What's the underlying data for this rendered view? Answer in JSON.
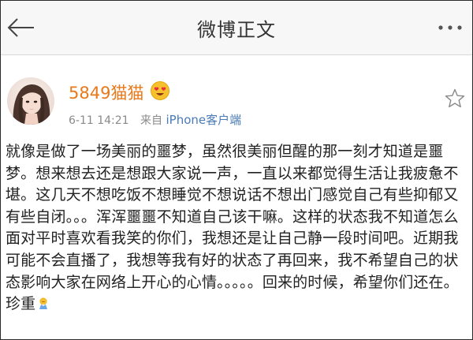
{
  "header": {
    "title": "微博正文",
    "back_icon": "arrow-left-icon",
    "more_icon": "more-dots-icon"
  },
  "post": {
    "username": "5849猫猫",
    "username_color": "#e8791a",
    "badge_icon": "vip-heart-eyes-emoji-icon",
    "time": "6-11 14:21",
    "source_prefix": "来自",
    "source_app": "iPhone客户端",
    "favorite_icon": "star-outline-icon",
    "body_text": "就像是做了一场美丽的噩梦，虽然很美丽但醒的那一刻才知道是噩梦。想来想去还是想跟大家说一声，一直以来都觉得生活让我疲惫不堪。这几天不想吃饭不想睡觉不想说话不想出门感觉自己有些抑郁又有些自闭。。。浑浑噩噩不知道自己该干嘛。这样的状态我不知道怎么面对平时喜欢看我笑的你们，我想还是让自己静一段时间吧。近期我可能不会直播了，我想等我有好的状态了再回来，我不希望自己的状态影响大家在网络上开心的心情。。。。。回来的时候，希望你们还在。珍重",
    "body_emoji_icon": "pray-emoji-icon"
  }
}
